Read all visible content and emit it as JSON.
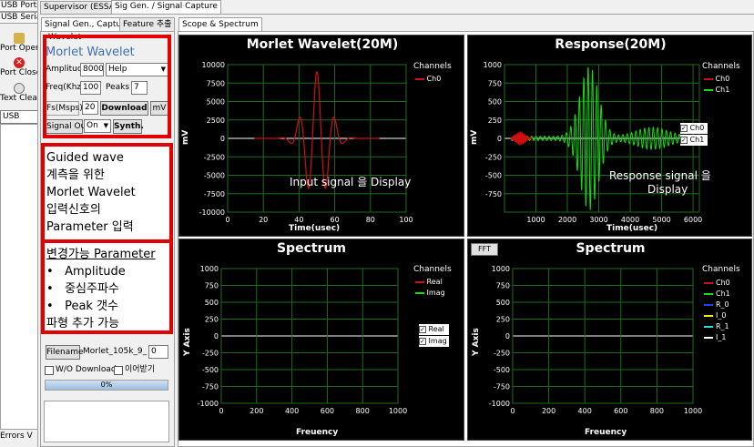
{
  "left_strip": {
    "tabs": [
      "USB Ports",
      "USB Serial"
    ],
    "buttons": [
      {
        "label": "Port Open",
        "icon": "port-open-icon",
        "color": "#d6b34a"
      },
      {
        "label": "Port Close",
        "icon": "port-close-icon",
        "color": "#d62020"
      },
      {
        "label": "Text Clear",
        "icon": "text-clear-icon",
        "color": "#e0e0e0"
      }
    ],
    "field_value": "USB",
    "errors_label": "Errors V"
  },
  "top_tabs": [
    "Supervisor (ESSA)",
    "Sig Gen. / Signal Capture"
  ],
  "sub_tabs": [
    "Signal Gen., Capture",
    "Feature 추출"
  ],
  "scope_tab": "Scope & Spectrum",
  "panel": {
    "group_title": "Wavelet",
    "wavelet_title": "Morlet Wavelet",
    "amplitude_label": "Amplitude",
    "amplitude_value": "8000",
    "help_value": "Help",
    "freq_label": "Freq(Khz)",
    "freq_value": "100",
    "peaks_label": "Peaks",
    "peaks_value": "7",
    "fs_label": "Fs(Msps)",
    "fs_value": "20",
    "download_label": "Download",
    "mv_label": "mV",
    "signal_out_label": "Signal Out",
    "signal_out_value": "On",
    "synth_label": "Synth.",
    "filename_label": "Filename",
    "filename_value": "Morlet_105k_9_",
    "filename_count": "0",
    "wo_download_label": "W/O Download",
    "append_label": "이어받기",
    "progress_text": "0%",
    "annotation_1": [
      "Guided wave",
      "계측을 위한",
      "Morlet Wavelet",
      "입력신호의",
      "Parameter 입력"
    ],
    "annotation_2_title": "변경가능 Parameter",
    "annotation_2_items": [
      "Amplitude",
      "중심주파수",
      "Peak 갯수"
    ],
    "annotation_2_footer": "파형 추가 가능"
  },
  "colors": {
    "red_box": "#e00000",
    "grid": "#1f6b1f",
    "ch0": "#d01010",
    "ch1": "#10e010"
  },
  "plots": {
    "morlet": {
      "title": "Morlet Wavelet(20M)",
      "ylabel": "mV",
      "xlabel": "Time(usec)",
      "legend_title": "Channels",
      "legend": [
        "Ch0"
      ],
      "overlay": "Input  signal 을 Display"
    },
    "response": {
      "title": "Response(20M)",
      "ylabel": "mV",
      "xlabel": "Time(usec)",
      "legend_title": "Channels",
      "legend": [
        "Ch0",
        "Ch1"
      ],
      "checks": [
        "Ch0",
        "Ch1"
      ],
      "overlay_1": "Response signal 을",
      "overlay_2": "Display"
    },
    "spectrum1": {
      "title": "Spectrum",
      "ylabel": "Y Axis",
      "xlabel": "Freuency",
      "legend_title": "Channels",
      "legend": [
        "Real",
        "Imag"
      ],
      "checks": [
        "Real",
        "Imag"
      ]
    },
    "spectrum2": {
      "title": "Spectrum",
      "ylabel": "Y Axis",
      "xlabel": "Freuency",
      "legend_title": "Channels",
      "legend": [
        "Ch0",
        "Ch1",
        "R_0",
        "I_0",
        "R_1",
        "I_1"
      ],
      "fft_button": "FFT"
    }
  },
  "chart_data": [
    {
      "type": "line",
      "title": "Morlet Wavelet(20M)",
      "xlabel": "Time(usec)",
      "ylabel": "mV",
      "xlim": [
        0,
        100
      ],
      "ylim": [
        -10000,
        10000
      ],
      "xticks": [
        0,
        20,
        40,
        60,
        80,
        100
      ],
      "yticks": [
        10000,
        7500,
        5000,
        2500,
        0,
        -2500,
        -5000,
        -7500,
        -10000
      ],
      "series": [
        {
          "name": "Ch0",
          "color": "#d01010",
          "center": 50,
          "freq_khz": 100,
          "amplitude": 9000,
          "width": 20
        }
      ]
    },
    {
      "type": "line",
      "title": "Response(20M)",
      "xlabel": "Time(usec)",
      "ylabel": "mV",
      "xlim": [
        0,
        6200
      ],
      "ylim": [
        -1000,
        1000
      ],
      "xticks": [
        1000,
        2000,
        3000,
        4000,
        5000,
        6000
      ],
      "yticks": [
        1000,
        750,
        500,
        250,
        0,
        -250,
        -500,
        -750
      ],
      "series": [
        {
          "name": "Ch0",
          "color": "#d01010"
        },
        {
          "name": "Ch1",
          "color": "#10e010"
        }
      ]
    },
    {
      "type": "line",
      "title": "Spectrum",
      "xlabel": "Freuency",
      "ylabel": "Y Axis",
      "xlim": [
        0,
        1000
      ],
      "ylim": [
        -1000,
        1000
      ],
      "xticks": [
        0,
        200,
        400,
        600,
        800,
        1000
      ],
      "yticks": [
        1000,
        750,
        500,
        250,
        0,
        -250,
        -500,
        -750,
        -1000
      ],
      "series": [
        {
          "name": "Real",
          "color": "#d01010"
        },
        {
          "name": "Imag",
          "color": "#10e010"
        }
      ]
    },
    {
      "type": "line",
      "title": "Spectrum",
      "xlabel": "Freuency",
      "ylabel": "Y Axis",
      "xlim": [
        0,
        1000
      ],
      "ylim": [
        -1000,
        1000
      ],
      "xticks": [
        0,
        200,
        400,
        600,
        800,
        1000
      ],
      "yticks": [
        1000,
        750,
        500,
        250,
        0,
        -250,
        -500,
        -750,
        -1000
      ],
      "series": [
        {
          "name": "Ch0",
          "color": "#d01010"
        },
        {
          "name": "Ch1",
          "color": "#10e010"
        },
        {
          "name": "R_0",
          "color": "#2040ff"
        },
        {
          "name": "I_0",
          "color": "#f0f000"
        },
        {
          "name": "R_1",
          "color": "#20e0e0"
        },
        {
          "name": "I_1",
          "color": "#ffffff"
        }
      ]
    }
  ]
}
